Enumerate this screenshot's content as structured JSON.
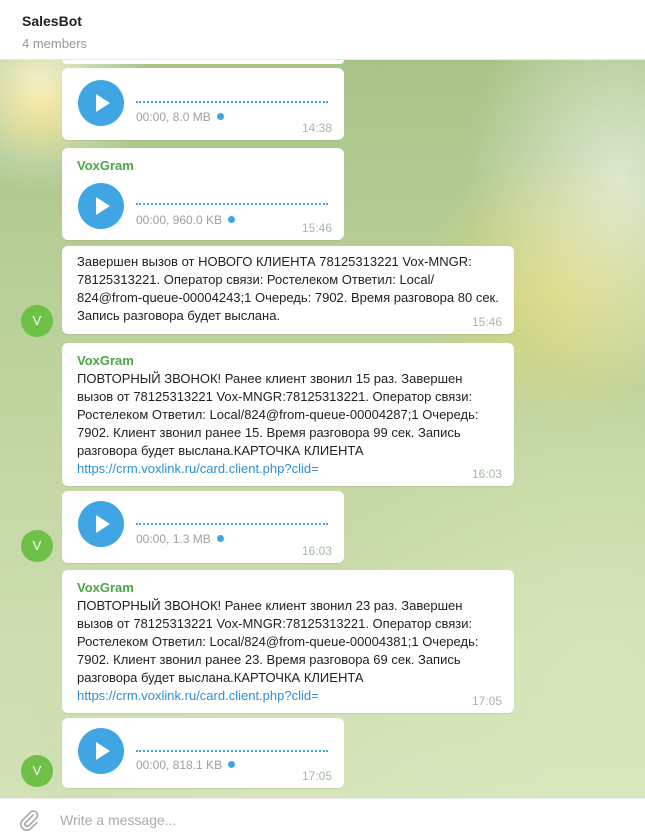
{
  "header": {
    "title": "SalesBot",
    "subtitle": "4 members"
  },
  "colors": {
    "sender": "#4ca646",
    "accent": "#3fa5e3",
    "avatar": "#6ec046",
    "link": "#2e8fd4"
  },
  "avatar_letter": "V",
  "messages": [
    {
      "type": "audio",
      "sender": "",
      "duration": "00:00, 8.0 MB",
      "time": "14:38"
    },
    {
      "type": "audio",
      "sender": "VoxGram",
      "duration": "00:00, 960.0 KB",
      "time": "15:46"
    },
    {
      "type": "text",
      "sender": "",
      "text": "Завершен вызов от НОВОГО КЛИЕНТА 78125313221 Vox-MNGR: 78125313221. Оператор связи: Ростелеком Ответил: Local/ 824@from-queue-00004243;1 Очередь: 7902. Время разговора 80 сек. Запись разговора будет выслана.",
      "time": "15:46"
    },
    {
      "type": "text",
      "sender": "VoxGram",
      "text": "ПОВТОРНЫЙ ЗВОНОК! Ранее клиент звонил 15 раз. Завершен вызов от 78125313221 Vox-MNGR:78125313221. Оператор связи: Ростелеком Ответил: Local/824@from-queue-00004287;1 Очередь: 7902. Клиент звонил ранее 15. Время разговора 99 сек. Запись разговора будет выслана.КАРТОЧКА КЛИЕНТА",
      "link": "https://crm.voxlink.ru/card.client.php?clid=",
      "time": "16:03"
    },
    {
      "type": "audio",
      "sender": "",
      "duration": "00:00, 1.3 MB",
      "time": "16:03"
    },
    {
      "type": "text",
      "sender": "VoxGram",
      "text": "ПОВТОРНЫЙ ЗВОНОК! Ранее клиент звонил 23 раз. Завершен вызов от 78125313221 Vox-MNGR:78125313221. Оператор связи: Ростелеком Ответил: Local/824@from-queue-00004381;1 Очередь: 7902. Клиент звонил ранее 23. Время разговора 69 сек. Запись разговора будет выслана.КАРТОЧКА КЛИЕНТА",
      "link": "https://crm.voxlink.ru/card.client.php?clid=",
      "time": "17:05"
    },
    {
      "type": "audio",
      "sender": "",
      "duration": "00:00, 818.1 KB",
      "time": "17:05"
    }
  ],
  "composer": {
    "placeholder": "Write a message..."
  },
  "icons": {
    "play": "play-icon",
    "attach": "paperclip-icon"
  }
}
